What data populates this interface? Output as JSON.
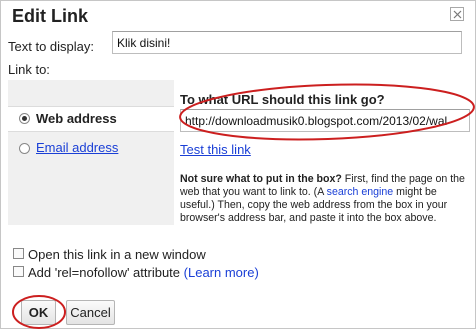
{
  "dialog": {
    "title": "Edit Link",
    "close_icon": "close-x-icon"
  },
  "display": {
    "label": "Text to display:",
    "value": "Klik disini!"
  },
  "link_to": {
    "label": "Link to:",
    "options": [
      {
        "label": "Web address",
        "selected": true
      },
      {
        "label": "Email address",
        "selected": false
      }
    ]
  },
  "url": {
    "question": "To what URL should this link go?",
    "value": "http://downloadmusik0.blogspot.com/2013/02/wal",
    "test_link": "Test this link"
  },
  "help": {
    "bold": "Not sure what to put in the box?",
    "text_1": " First, find the page on the web that you want to link to. (A ",
    "link": "search engine",
    "text_2": " might be useful.) Then, copy the web address from the box in your browser's address bar, and paste it into the box above."
  },
  "options": {
    "new_window": "Open this link in a new window",
    "nofollow": "Add 'rel=nofollow' attribute",
    "learn_more": "(Learn more)"
  },
  "buttons": {
    "ok": "OK",
    "cancel": "Cancel"
  },
  "colors": {
    "annotation": "#cc1f1f",
    "link": "#1a3fd6"
  }
}
